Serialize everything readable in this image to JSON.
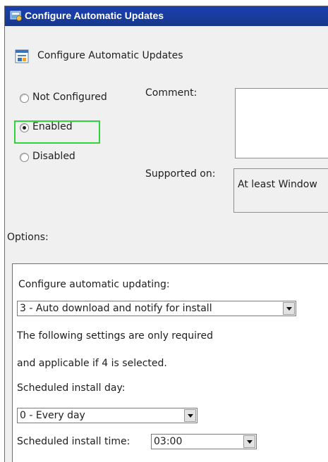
{
  "window": {
    "title": "Configure Automatic Updates"
  },
  "header": {
    "title": "Configure Automatic Updates"
  },
  "state_options": [
    {
      "label": "Not Configured",
      "selected": false
    },
    {
      "label": "Enabled",
      "selected": true
    },
    {
      "label": "Disabled",
      "selected": false
    }
  ],
  "comment": {
    "label": "Comment:",
    "value": ""
  },
  "supported_on": {
    "label": "Supported on:",
    "value": "At least Window"
  },
  "options": {
    "label": "Options:",
    "configure_label": "Configure automatic updating:",
    "configure_value": "3 - Auto download and notify for install",
    "note_line1": "The following settings are only required",
    "note_line2": "and applicable if 4 is selected.",
    "install_day_label": "Scheduled install day:",
    "install_day_value": "0 - Every day",
    "install_time_label": "Scheduled install time:",
    "install_time_value": "03:00"
  },
  "colors": {
    "titlebar": "#183c9c",
    "highlight": "#2fd33a",
    "window_bg": "#f0f0f0"
  },
  "icons": {
    "app": "group-policy-icon",
    "header": "setting-icon",
    "dropdown": "chevron-down-icon"
  }
}
